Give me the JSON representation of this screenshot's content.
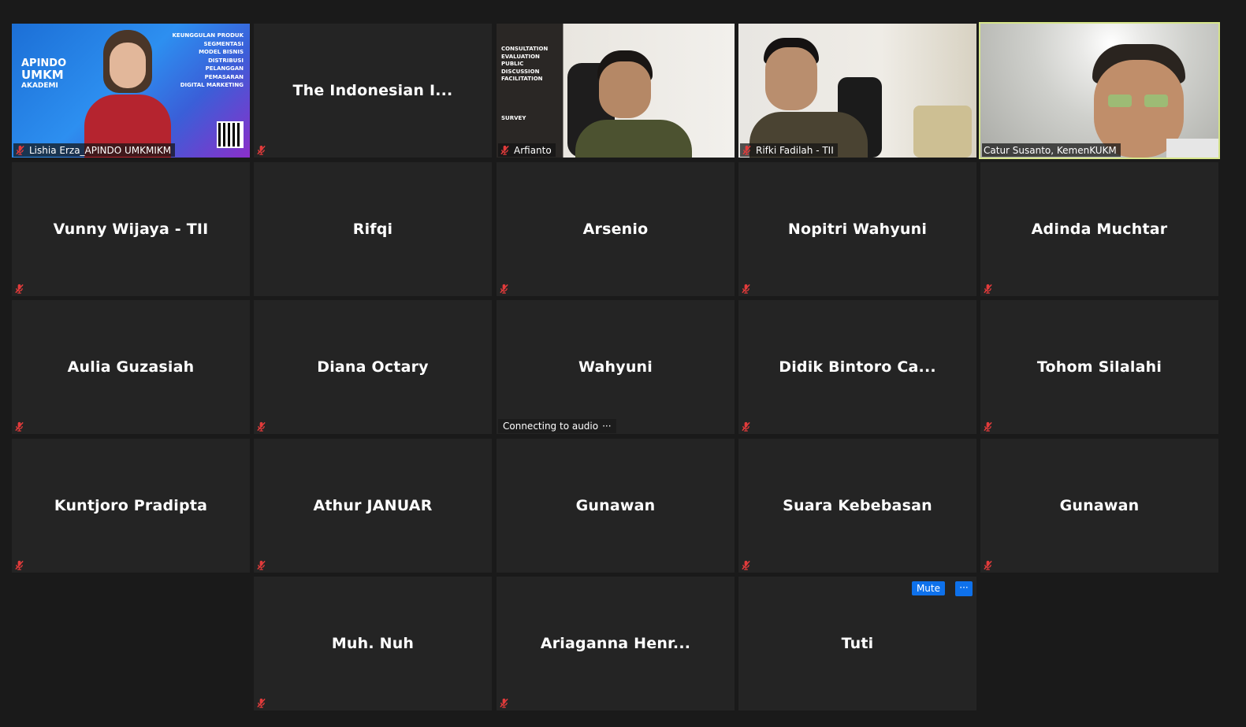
{
  "participants": {
    "t1": {
      "name": "Lishia Erza_APINDO UMKMIKM",
      "poster": {
        "logo_line1": "APINDO",
        "logo_line2": "UMKM",
        "logo_line3": "AKADEMI",
        "topics": [
          "KEUNGGULAN PRODUK",
          "SEGMENTASI",
          "MODEL BISNIS",
          "DISTRIBUSI",
          "PELANGGAN",
          "PEMASARAN",
          "DIGITAL MARKETING"
        ]
      }
    },
    "t2": {
      "name": "The Indonesian I..."
    },
    "t3": {
      "name": "Arfianto",
      "banner": [
        "CONSULTATION",
        "EVALUATION",
        "PUBLIC",
        "DISCUSSION",
        "FACILITATION",
        "SURVEY"
      ]
    },
    "t4": {
      "name": "Rifki Fadilah - TII"
    },
    "t5": {
      "name": "Catur Susanto, KemenKUKM"
    },
    "t6": {
      "name": "Vunny Wijaya - TII"
    },
    "t7": {
      "name": "Rifqi"
    },
    "t8": {
      "name": "Arsenio"
    },
    "t9": {
      "name": "Nopitri Wahyuni"
    },
    "t10": {
      "name": "Adinda Muchtar"
    },
    "t11": {
      "name": "Aulia Guzasiah"
    },
    "t12": {
      "name": "Diana Octary"
    },
    "t13": {
      "name": "Wahyuni",
      "status": "Connecting to audio",
      "status_icon": "···"
    },
    "t14": {
      "name": "Didik Bintoro Ca..."
    },
    "t15": {
      "name": "Tohom Silalahi"
    },
    "t16": {
      "name": "Kuntjoro Pradipta"
    },
    "t17": {
      "name": "Athur JANUAR"
    },
    "t18": {
      "name": "Gunawan"
    },
    "t19": {
      "name": "Suara Kebebasan"
    },
    "t20": {
      "name": "Gunawan"
    },
    "t21": {
      "name": "Muh. Nuh"
    },
    "t22": {
      "name": "Ariaganna Henr..."
    },
    "t23": {
      "name": "Tuti",
      "mute_label": "Mute",
      "more_label": "···"
    }
  },
  "colors": {
    "background": "#1a1a1a",
    "tile": "#242424",
    "active_speaker": "#d6e58a",
    "muted_icon": "#e02828",
    "button": "#0e71eb"
  }
}
